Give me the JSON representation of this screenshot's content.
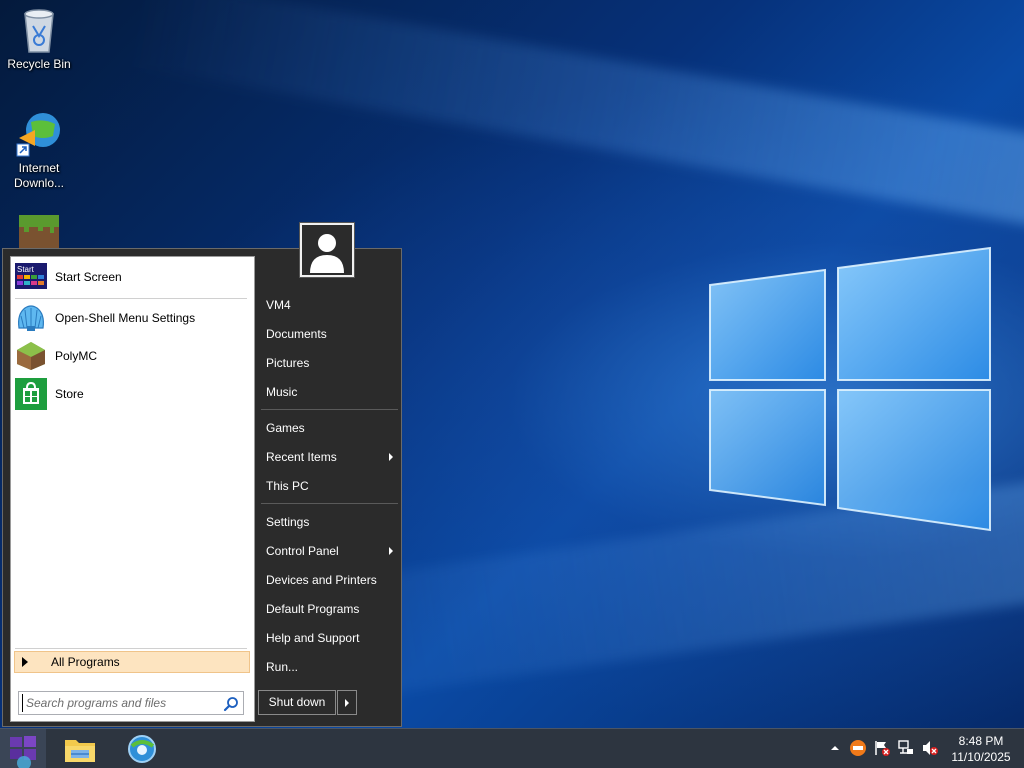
{
  "desktop": {
    "icons": [
      {
        "label": "Recycle Bin",
        "icon": "recycle-bin-icon"
      },
      {
        "label": "Internet Downlo...",
        "icon": "internet-download-manager-icon"
      },
      {
        "label": "",
        "icon": "minecraft-grass-block-icon"
      }
    ]
  },
  "start_menu": {
    "user_picture": "user-avatar-icon",
    "programs": [
      {
        "label": "Start Screen",
        "icon": "start-screen-icon"
      },
      {
        "label": "Open-Shell Menu Settings",
        "icon": "open-shell-icon"
      },
      {
        "label": "PolyMC",
        "icon": "polymc-icon"
      },
      {
        "label": "Store",
        "icon": "store-icon"
      }
    ],
    "all_programs": "All Programs",
    "search": {
      "placeholder": "Search programs and files"
    },
    "right_items": [
      {
        "label": "VM4"
      },
      {
        "label": "Documents"
      },
      {
        "label": "Pictures"
      },
      {
        "label": "Music"
      },
      {
        "label": "Games"
      },
      {
        "label": "Recent Items",
        "submenu": true
      },
      {
        "label": "This PC"
      },
      {
        "label": "Settings"
      },
      {
        "label": "Control Panel",
        "submenu": true
      },
      {
        "label": "Devices and Printers"
      },
      {
        "label": "Default Programs"
      },
      {
        "label": "Help and Support"
      },
      {
        "label": "Run..."
      }
    ],
    "shutdown": "Shut down",
    "start_screen_tile_text": "Start"
  },
  "taskbar": {
    "apps": [
      {
        "icon": "file-explorer-icon"
      },
      {
        "icon": "browser-icon"
      }
    ],
    "clock": {
      "time": "8:48 PM",
      "date": "11/10/2025"
    }
  },
  "colors": {
    "menu_dark": "#2b2b2b",
    "all_programs_highlight": "#fde4c0",
    "taskbar": "#2d3540"
  }
}
